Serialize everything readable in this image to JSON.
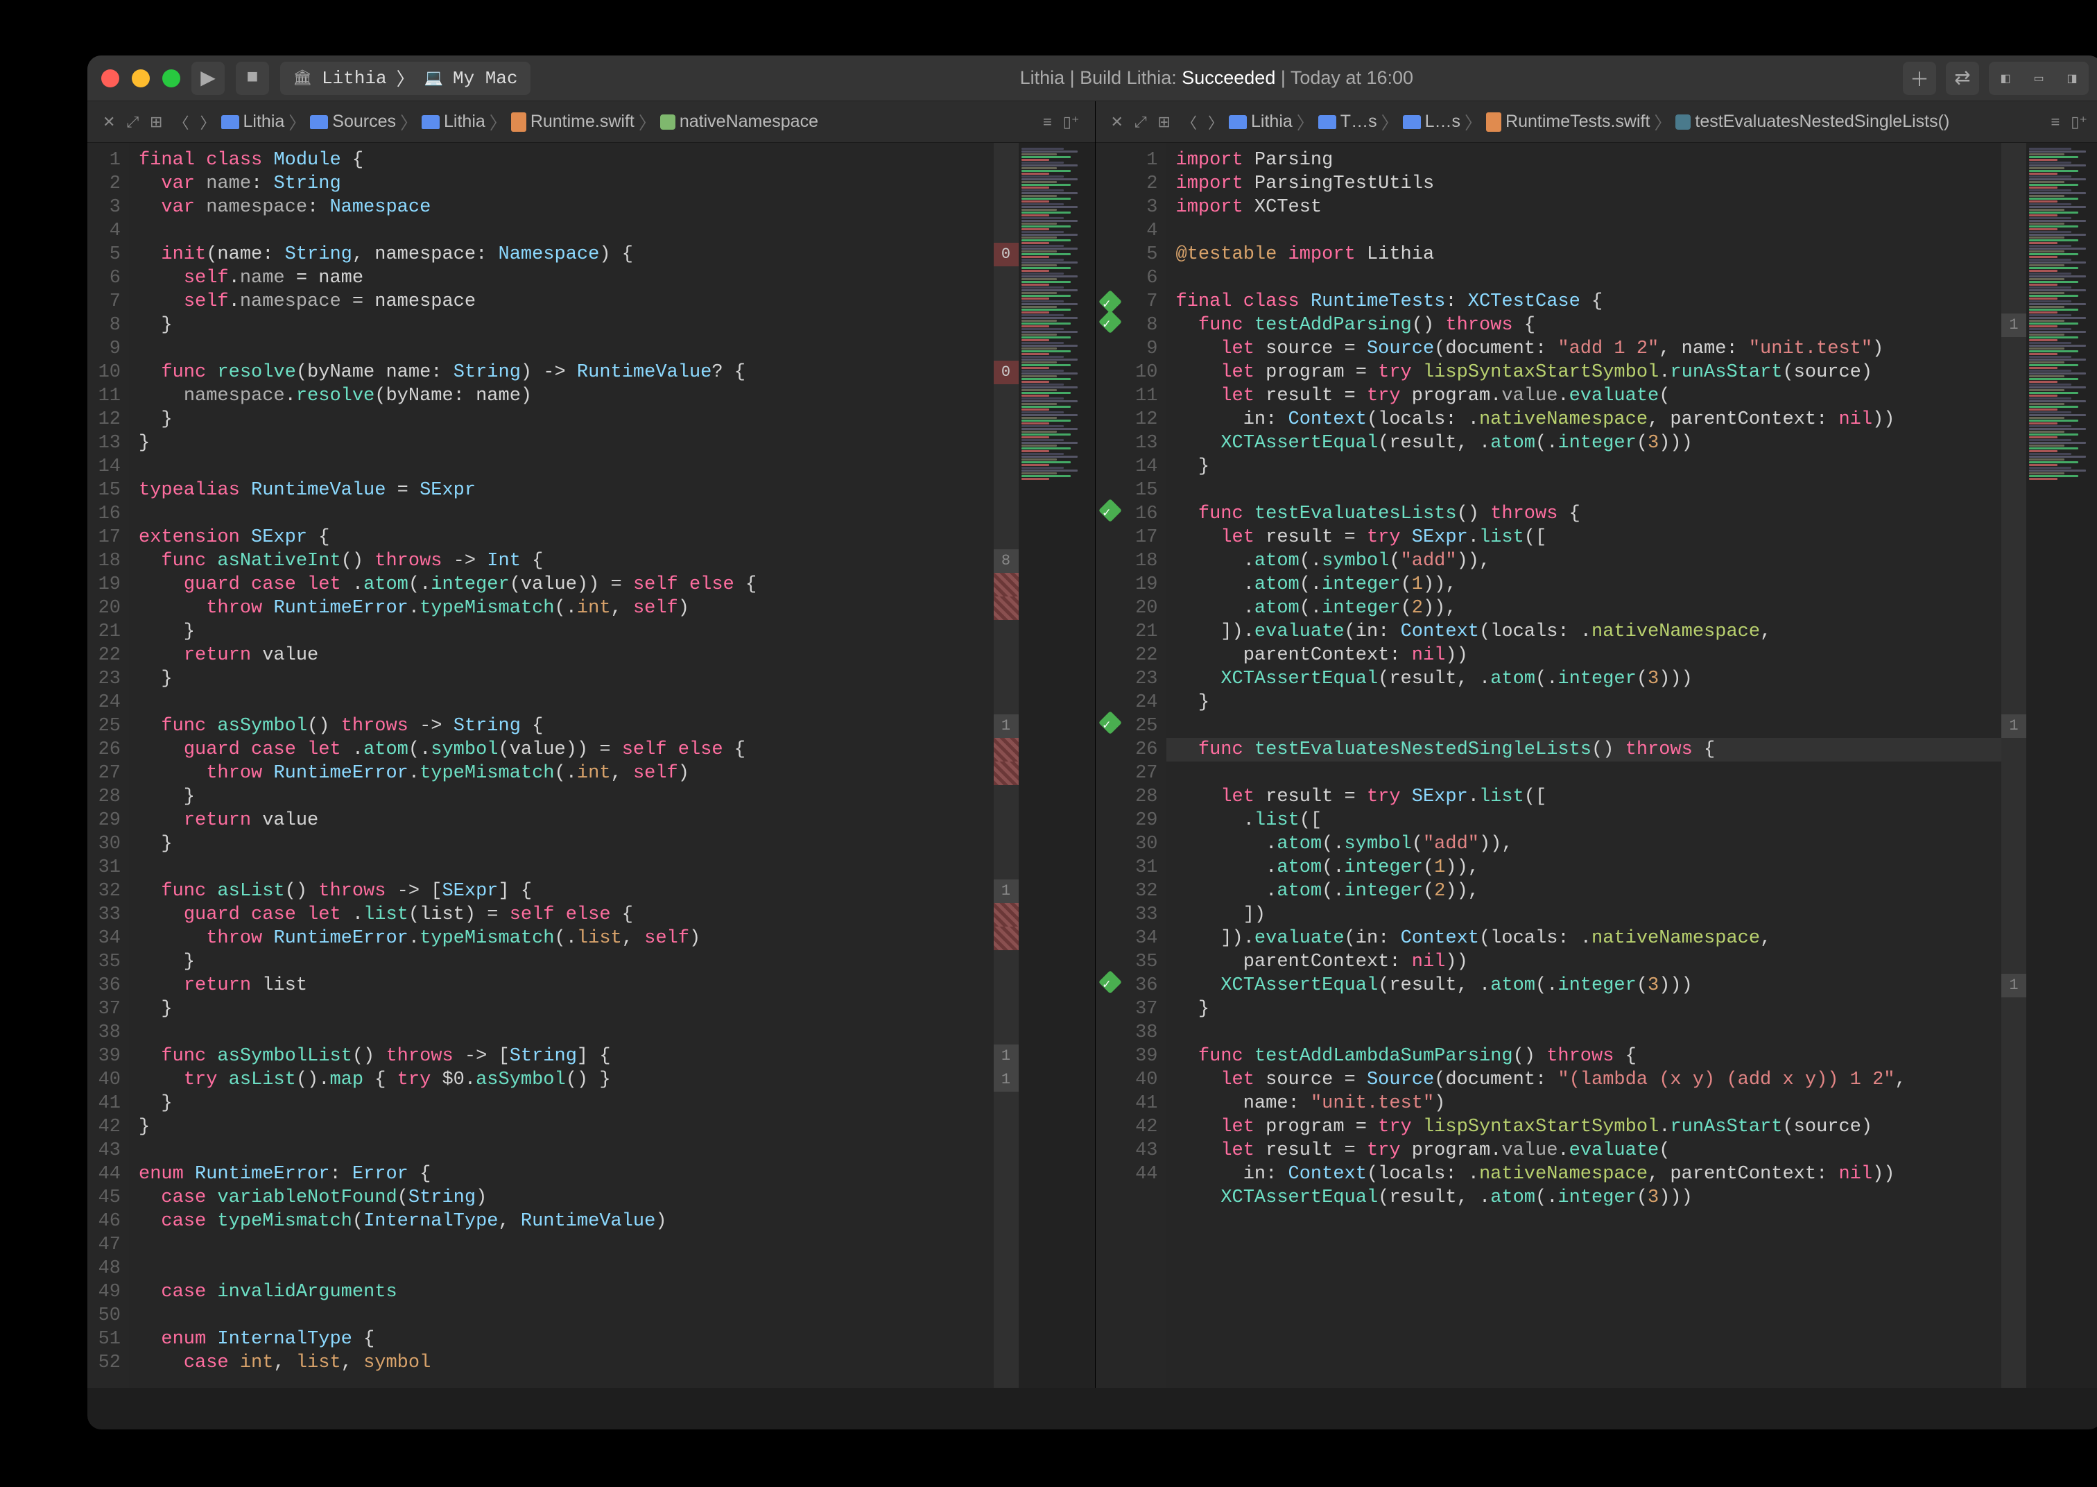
{
  "titlebar": {
    "scheme": "Lithia",
    "destination": "My Mac",
    "status_prefix": "Lithia | Build Lithia: ",
    "status_result": "Succeeded",
    "status_suffix": " | Today at 16:00"
  },
  "left": {
    "path": [
      "Lithia",
      "Sources",
      "Lithia",
      "Runtime.swift",
      "nativeNamespace"
    ],
    "lines": [
      1,
      2,
      3,
      4,
      5,
      6,
      7,
      8,
      9,
      10,
      11,
      12,
      13,
      14,
      15,
      16,
      17,
      18,
      19,
      20,
      21,
      22,
      23,
      24,
      25,
      26,
      27,
      28,
      29,
      30,
      31,
      32,
      33,
      34,
      35,
      36,
      37,
      38,
      39,
      40,
      41,
      42,
      43,
      44,
      45,
      46,
      47,
      48,
      49,
      50,
      51,
      52
    ],
    "annot": {
      "5": "0",
      "10": "0",
      "18": "8",
      "19": "h",
      "20": "h",
      "25": "1",
      "26": "h",
      "27": "h",
      "32": "1",
      "33": "h",
      "34": "h",
      "39": "1",
      "40": "1"
    }
  },
  "right": {
    "path": [
      "Lithia",
      "T…s",
      "L…s",
      "RuntimeTests.swift",
      "testEvaluatesNestedSingleLists()"
    ],
    "lines": [
      1,
      2,
      3,
      4,
      5,
      6,
      7,
      8,
      9,
      10,
      11,
      12,
      13,
      14,
      15,
      16,
      17,
      18,
      19,
      20,
      21,
      22,
      23,
      24,
      25,
      26,
      27,
      28,
      29,
      30,
      31,
      32,
      33,
      34,
      35,
      36,
      37,
      38,
      39,
      40,
      41,
      42,
      43,
      44
    ],
    "tests": {
      "7": true,
      "8": true,
      "16": true,
      "25": true,
      "36": true
    },
    "annot": {
      "8": "1",
      "25": "1",
      "36": "1"
    }
  },
  "code_left": [
    "<span class='k'>final</span> <span class='k'>class</span> <span class='t'>Module</span> {",
    "  <span class='k'>var</span> <span class='prop'>name</span>: <span class='t'>String</span>",
    "  <span class='k'>var</span> <span class='prop'>namespace</span>: <span class='t'>Namespace</span>",
    "",
    "  <span class='k'>init</span>(name: <span class='t'>String</span>, namespace: <span class='t'>Namespace</span>) {",
    "    <span class='k'>self</span>.<span class='prop'>name</span> = name",
    "    <span class='k'>self</span>.<span class='prop'>namespace</span> = namespace",
    "  }",
    "",
    "  <span class='k'>func</span> <span class='fn'>resolve</span>(byName name: <span class='t'>String</span>) -> <span class='t'>RuntimeValue</span>? {",
    "    <span class='prop'>namespace</span>.<span class='fn'>resolve</span>(byName: name)",
    "  }",
    "}",
    "",
    "<span class='k'>typealias</span> <span class='t'>RuntimeValue</span> = <span class='t'>SExpr</span>",
    "",
    "<span class='k'>extension</span> <span class='t'>SExpr</span> {",
    "  <span class='k'>func</span> <span class='fn'>asNativeInt</span>() <span class='k'>throws</span> -> <span class='t'>Int</span> {",
    "    <span class='k'>guard</span> <span class='k'>case</span> <span class='k'>let</span> .<span class='fn'>atom</span>(.<span class='fn'>integer</span>(value)) = <span class='k'>self</span> <span class='k'>else</span> {",
    "      <span class='k'>throw</span> <span class='t'>RuntimeError</span>.<span class='fn'>typeMismatch</span>(.<span class='lit'>int</span>, <span class='k'>self</span>)",
    "    }",
    "    <span class='k'>return</span> value",
    "  }",
    "",
    "  <span class='k'>func</span> <span class='fn'>asSymbol</span>() <span class='k'>throws</span> -> <span class='t'>String</span> {",
    "    <span class='k'>guard</span> <span class='k'>case</span> <span class='k'>let</span> .<span class='fn'>atom</span>(.<span class='fn'>symbol</span>(value)) = <span class='k'>self</span> <span class='k'>else</span> {",
    "      <span class='k'>throw</span> <span class='t'>RuntimeError</span>.<span class='fn'>typeMismatch</span>(.<span class='lit'>int</span>, <span class='k'>self</span>)",
    "    }",
    "    <span class='k'>return</span> value",
    "  }",
    "",
    "  <span class='k'>func</span> <span class='fn'>asList</span>() <span class='k'>throws</span> -> [<span class='t'>SExpr</span>] {",
    "    <span class='k'>guard</span> <span class='k'>case</span> <span class='k'>let</span> .<span class='fn'>list</span>(list) = <span class='k'>self</span> <span class='k'>else</span> {",
    "      <span class='k'>throw</span> <span class='t'>RuntimeError</span>.<span class='fn'>typeMismatch</span>(.<span class='lit'>list</span>, <span class='k'>self</span>)",
    "    }",
    "    <span class='k'>return</span> list",
    "  }",
    "",
    "  <span class='k'>func</span> <span class='fn'>asSymbolList</span>() <span class='k'>throws</span> -> [<span class='t'>String</span>] {",
    "    <span class='k'>try</span> <span class='fn'>asList</span>().<span class='fn'>map</span> { <span class='k'>try</span> $0.<span class='fn'>asSymbol</span>() }",
    "  }",
    "}",
    "",
    "<span class='k'>enum</span> <span class='t'>RuntimeError</span>: <span class='t'>Error</span> {",
    "  <span class='k'>case</span> <span class='fn'>variableNotFound</span>(<span class='t'>String</span>)",
    "  <span class='k'>case</span> <span class='fn'>typeMismatch</span>(<span class='t'>InternalType</span>, <span class='t'>RuntimeValue</span>)",
    "",
    "",
    "  <span class='k'>case</span> <span class='fn'>invalidArguments</span>",
    "",
    "  <span class='k'>enum</span> <span class='t'>InternalType</span> {",
    "    <span class='k'>case</span> <span class='lit'>int</span>, <span class='lit'>list</span>, <span class='lit'>symbol</span>",
    "  }"
  ],
  "code_right": [
    "<span class='k'>import</span> <span class='id'>Parsing</span>",
    "<span class='k'>import</span> <span class='id'>ParsingTestUtils</span>",
    "<span class='k'>import</span> <span class='id'>XCTest</span>",
    "",
    "<span class='pp'>@testable</span> <span class='k'>import</span> <span class='id'>Lithia</span>",
    "",
    "<span class='k'>final</span> <span class='k'>class</span> <span class='t'>RuntimeTests</span>: <span class='t'>XCTestCase</span> {",
    "  <span class='k'>func</span> <span class='fn'>testAddParsing</span>() <span class='k'>throws</span> {",
    "    <span class='k'>let</span> source = <span class='t'>Source</span>(document: <span class='s'>\"add 1 2\"</span>, name: <span class='s'>\"unit.test\"</span>)",
    "    <span class='k'>let</span> program = <span class='k'>try</span> <span class='ns'>lispSyntaxStartSymbol</span>.<span class='fn'>runAsStart</span>(source)",
    "    <span class='k'>let</span> result = <span class='k'>try</span> program.<span class='prop'>value</span>.<span class='fn'>evaluate</span>(",
    "      in: <span class='t'>Context</span>(locals: .<span class='ns'>nativeNamespace</span>, parentContext: <span class='k'>nil</span>))",
    "    <span class='fn'>XCTAssertEqual</span>(result, .<span class='fn'>atom</span>(.<span class='fn'>integer</span>(<span class='num'>3</span>)))",
    "  }",
    "",
    "  <span class='k'>func</span> <span class='fn'>testEvaluatesLists</span>() <span class='k'>throws</span> {",
    "    <span class='k'>let</span> result = <span class='k'>try</span> <span class='t'>SExpr</span>.<span class='fn'>list</span>([",
    "      .<span class='fn'>atom</span>(.<span class='fn'>symbol</span>(<span class='s'>\"add\"</span>)),",
    "      .<span class='fn'>atom</span>(.<span class='fn'>integer</span>(<span class='num'>1</span>)),",
    "      .<span class='fn'>atom</span>(.<span class='fn'>integer</span>(<span class='num'>2</span>)),",
    "    ]).<span class='fn'>evaluate</span>(in: <span class='t'>Context</span>(locals: .<span class='ns'>nativeNamespace</span>,",
    "      parentContext: <span class='k'>nil</span>))",
    "    <span class='fn'>XCTAssertEqual</span>(result, .<span class='fn'>atom</span>(.<span class='fn'>integer</span>(<span class='num'>3</span>)))",
    "  }",
    "",
    "  <span class='k'>func</span> <span class='fn'>testEvaluatesNestedSingleLists</span>() <span class='k'>throws</span> {",
    "    <span class='k'>let</span> result = <span class='k'>try</span> <span class='t'>SExpr</span>.<span class='fn'>list</span>([",
    "      .<span class='fn'>list</span>([",
    "        .<span class='fn'>atom</span>(.<span class='fn'>symbol</span>(<span class='s'>\"add\"</span>)),",
    "        .<span class='fn'>atom</span>(.<span class='fn'>integer</span>(<span class='num'>1</span>)),",
    "        .<span class='fn'>atom</span>(.<span class='fn'>integer</span>(<span class='num'>2</span>)),",
    "      ])",
    "    ]).<span class='fn'>evaluate</span>(in: <span class='t'>Context</span>(locals: .<span class='ns'>nativeNamespace</span>,",
    "      parentContext: <span class='k'>nil</span>))",
    "    <span class='fn'>XCTAssertEqual</span>(result, .<span class='fn'>atom</span>(.<span class='fn'>integer</span>(<span class='num'>3</span>)))",
    "  }",
    "",
    "  <span class='k'>func</span> <span class='fn'>testAddLambdaSumParsing</span>() <span class='k'>throws</span> {",
    "    <span class='k'>let</span> source = <span class='t'>Source</span>(document: <span class='s'>\"(lambda (x y) (add x y)) 1 2\"</span>,",
    "      name: <span class='s'>\"unit.test\"</span>)",
    "    <span class='k'>let</span> program = <span class='k'>try</span> <span class='ns'>lispSyntaxStartSymbol</span>.<span class='fn'>runAsStart</span>(source)",
    "    <span class='k'>let</span> result = <span class='k'>try</span> program.<span class='prop'>value</span>.<span class='fn'>evaluate</span>(",
    "      in: <span class='t'>Context</span>(locals: .<span class='ns'>nativeNamespace</span>, parentContext: <span class='k'>nil</span>))",
    "    <span class='fn'>XCTAssertEqual</span>(result, .<span class='fn'>atom</span>(.<span class='fn'>integer</span>(<span class='num'>3</span>)))",
    "  }",
    "}",
    ""
  ]
}
